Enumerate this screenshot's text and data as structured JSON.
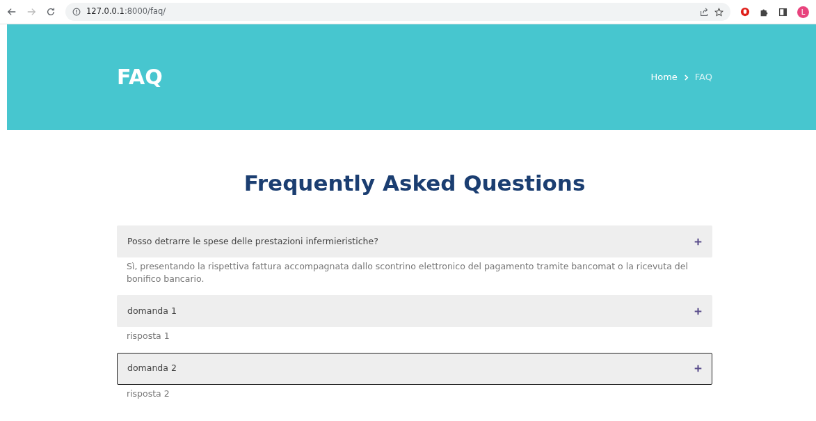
{
  "browser": {
    "url_host": "127.0.0.1",
    "url_path": ":8000/faq/",
    "profile_initial": "L"
  },
  "header": {
    "title": "FAQ",
    "breadcrumb": [
      {
        "label": "Home",
        "current": false
      },
      {
        "label": "FAQ",
        "current": true
      }
    ]
  },
  "heading": "Frequently Asked Questions",
  "faq": [
    {
      "question": "Posso detrarre le spese delle prestazioni infermieristiche?",
      "answer": "Sì, presentando la rispettiva fattura accompagnata dallo scontrino elettronico del pagamento tramite bancomat o la ricevuta del bonifico bancario.",
      "selected": false
    },
    {
      "question": "domanda 1",
      "answer": "risposta 1",
      "selected": false
    },
    {
      "question": "domanda 2",
      "answer": "risposta 2",
      "selected": true
    }
  ]
}
